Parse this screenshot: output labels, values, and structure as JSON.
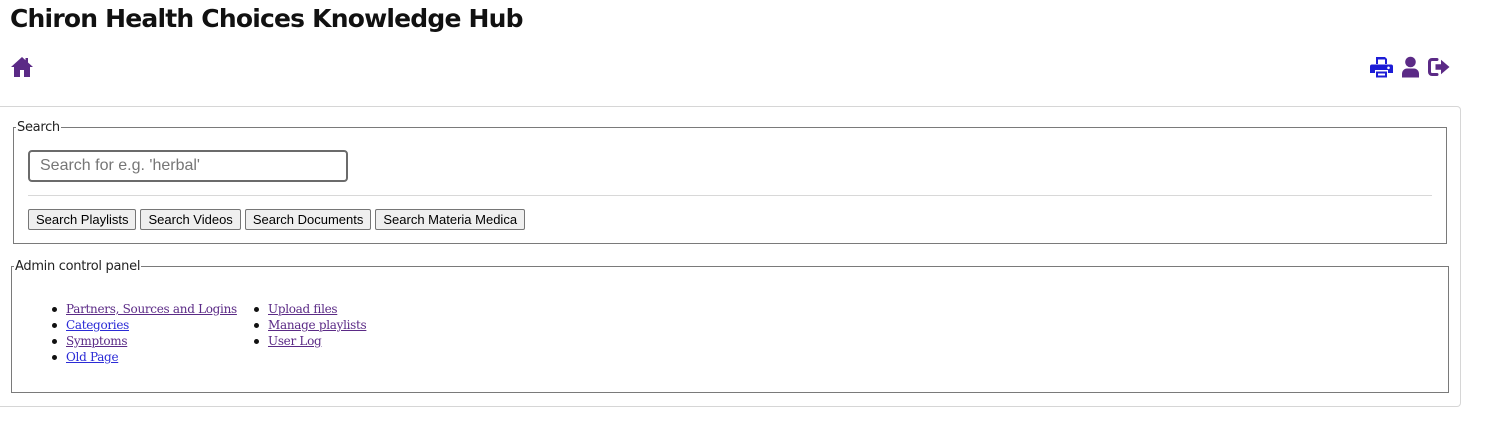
{
  "header": {
    "title": "Chiron Health Choices Knowledge Hub",
    "home_icon": "home-icon",
    "right_icons": [
      "print-icon",
      "user-icon",
      "sign-out-icon"
    ]
  },
  "colors": {
    "home_icon": "#5b2a86",
    "print_icon": "#1c1cd6",
    "user_icon": "#5b2a86",
    "sign_out_icon": "#5b2a86",
    "visited_link": "#5b2a86",
    "link": "#2b2bd6"
  },
  "search": {
    "legend": "Search",
    "placeholder": "Search for e.g. 'herbal'",
    "value": "",
    "buttons": [
      {
        "label": "Search Playlists"
      },
      {
        "label": "Search Videos"
      },
      {
        "label": "Search Documents"
      },
      {
        "label": "Search Materia Medica"
      }
    ]
  },
  "admin": {
    "legend": "Admin control panel",
    "column1": [
      {
        "label": "Partners, Sources and Logins"
      },
      {
        "label": "Categories"
      },
      {
        "label": "Symptoms"
      },
      {
        "label": "Old Page"
      }
    ],
    "column2": [
      {
        "label": "Upload files"
      },
      {
        "label": "Manage playlists"
      },
      {
        "label": "User Log"
      }
    ]
  }
}
